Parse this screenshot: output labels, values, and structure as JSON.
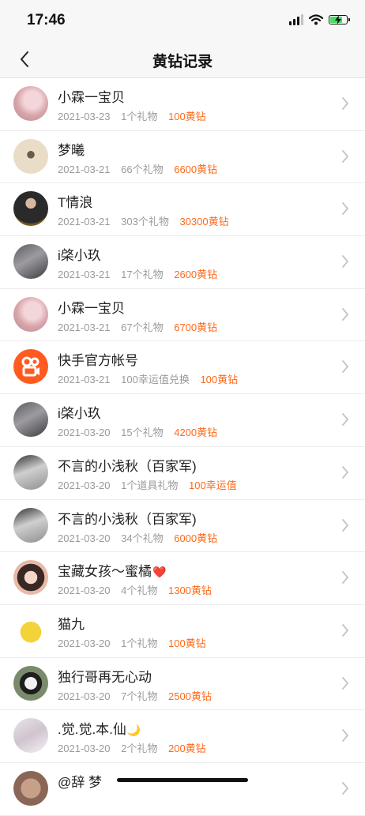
{
  "status_bar": {
    "time": "17:46",
    "icons": [
      "signal-icon",
      "wifi-icon",
      "battery-charging-icon"
    ]
  },
  "header": {
    "title": "黄钻记录",
    "back_icon": "chevron-left-icon"
  },
  "colors": {
    "amount": "#ff6a1a",
    "meta": "#9a9a9a",
    "kuaishou_brand": "#ff5a1f"
  },
  "records": [
    {
      "name": "小霖一宝贝",
      "date": "2021-03-23",
      "gifts": "1个礼物",
      "amount": "100黄钻",
      "avatar": "pink-portrait"
    },
    {
      "name": "梦曦",
      "date": "2021-03-21",
      "gifts": "66个礼物",
      "amount": "6600黄钻",
      "avatar": "beige-portrait"
    },
    {
      "name": "T情浪",
      "date": "2021-03-21",
      "gifts": "303个礼物",
      "amount": "30300黄钻",
      "avatar": "dark-portrait"
    },
    {
      "name": "i棨小玖",
      "date": "2021-03-21",
      "gifts": "17个礼物",
      "amount": "2600黄钻",
      "avatar": "gray-portrait"
    },
    {
      "name": "小霖一宝贝",
      "date": "2021-03-21",
      "gifts": "67个礼物",
      "amount": "6700黄钻",
      "avatar": "pink-portrait"
    },
    {
      "name": "快手官方帐号",
      "date": "2021-03-21",
      "gifts": "100幸运值兑换",
      "amount": "100黄钻",
      "avatar": "kuaishou-logo"
    },
    {
      "name": "i棨小玖",
      "date": "2021-03-20",
      "gifts": "15个礼物",
      "amount": "4200黄钻",
      "avatar": "gray-portrait"
    },
    {
      "name": "不言的小浅秋（百家军)",
      "date": "2021-03-20",
      "gifts": "1个道具礼物",
      "amount": "100幸运值",
      "avatar": "hand-portrait"
    },
    {
      "name": "不言的小浅秋（百家军)",
      "date": "2021-03-20",
      "gifts": "34个礼物",
      "amount": "6000黄钻",
      "avatar": "hand-portrait"
    },
    {
      "name": "宝藏女孩～蜜橘",
      "date": "2021-03-20",
      "gifts": "4个礼物",
      "amount": "1300黄钻",
      "avatar": "girl-portrait",
      "suffix": "❤️"
    },
    {
      "name": "猫九",
      "date": "2021-03-20",
      "gifts": "1个礼物",
      "amount": "100黄钻",
      "avatar": "yellow-chick"
    },
    {
      "name": "独行哥再无心动",
      "date": "2021-03-20",
      "gifts": "7个礼物",
      "amount": "2500黄钻",
      "avatar": "panda-portrait"
    },
    {
      "name": ".觉.觉.本.仙",
      "date": "2021-03-20",
      "gifts": "2个礼物",
      "amount": "200黄钻",
      "avatar": "light-portrait",
      "suffix": "🌙"
    },
    {
      "name": "@辞 梦",
      "date": "",
      "gifts": "",
      "amount": "",
      "avatar": "brown-portrait"
    }
  ]
}
